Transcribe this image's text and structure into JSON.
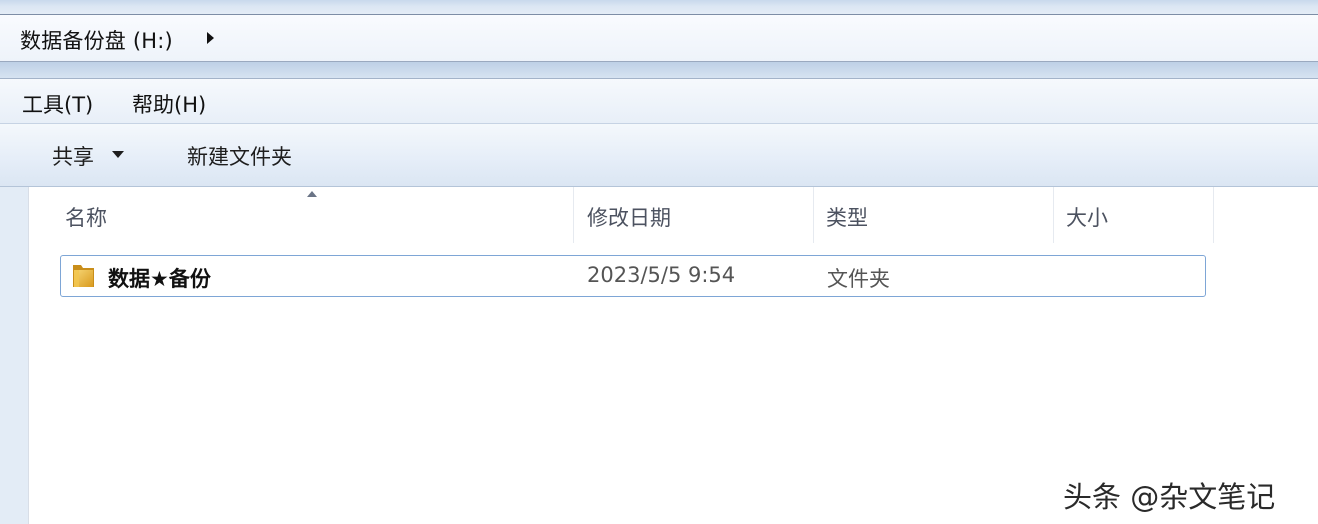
{
  "address": {
    "path_label": "数据备份盘 (H:)"
  },
  "menubar": {
    "items": [
      {
        "label": "工具(T)"
      },
      {
        "label": "帮助(H)"
      }
    ]
  },
  "toolbar": {
    "share_label": "共享",
    "new_folder_label": "新建文件夹"
  },
  "columns": {
    "name": "名称",
    "modified": "修改日期",
    "type": "类型",
    "size": "大小"
  },
  "files": [
    {
      "name": "数据★备份",
      "modified": "2023/5/5 9:54",
      "type": "文件夹",
      "size": "",
      "icon": "folder-icon"
    }
  ],
  "watermark": {
    "text": "头条 @杂文笔记"
  },
  "colors": {
    "selection_border": "#7ea6d6",
    "chrome_blue": "#dbe6f3",
    "folder_yellow": "#e8b637"
  }
}
